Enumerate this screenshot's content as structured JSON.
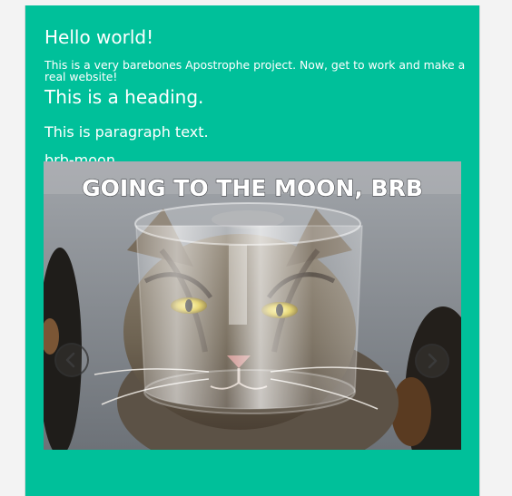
{
  "intro": {
    "greeting": "Hello world!",
    "description": "This is a very barebones Apostrophe project. Now, get to work and make a real website!"
  },
  "content": {
    "heading": "This is a heading.",
    "paragraph": "This is paragraph text.",
    "slideshow_caption": "brb-moon"
  },
  "slideshow": {
    "image_text": "GOING TO THE MOON, BRB",
    "prev_icon": "chevron-left-icon",
    "next_icon": "chevron-right-icon"
  },
  "colors": {
    "background": "#00c09a",
    "page_background": "#f3f3f3",
    "text": "#ffffff"
  }
}
